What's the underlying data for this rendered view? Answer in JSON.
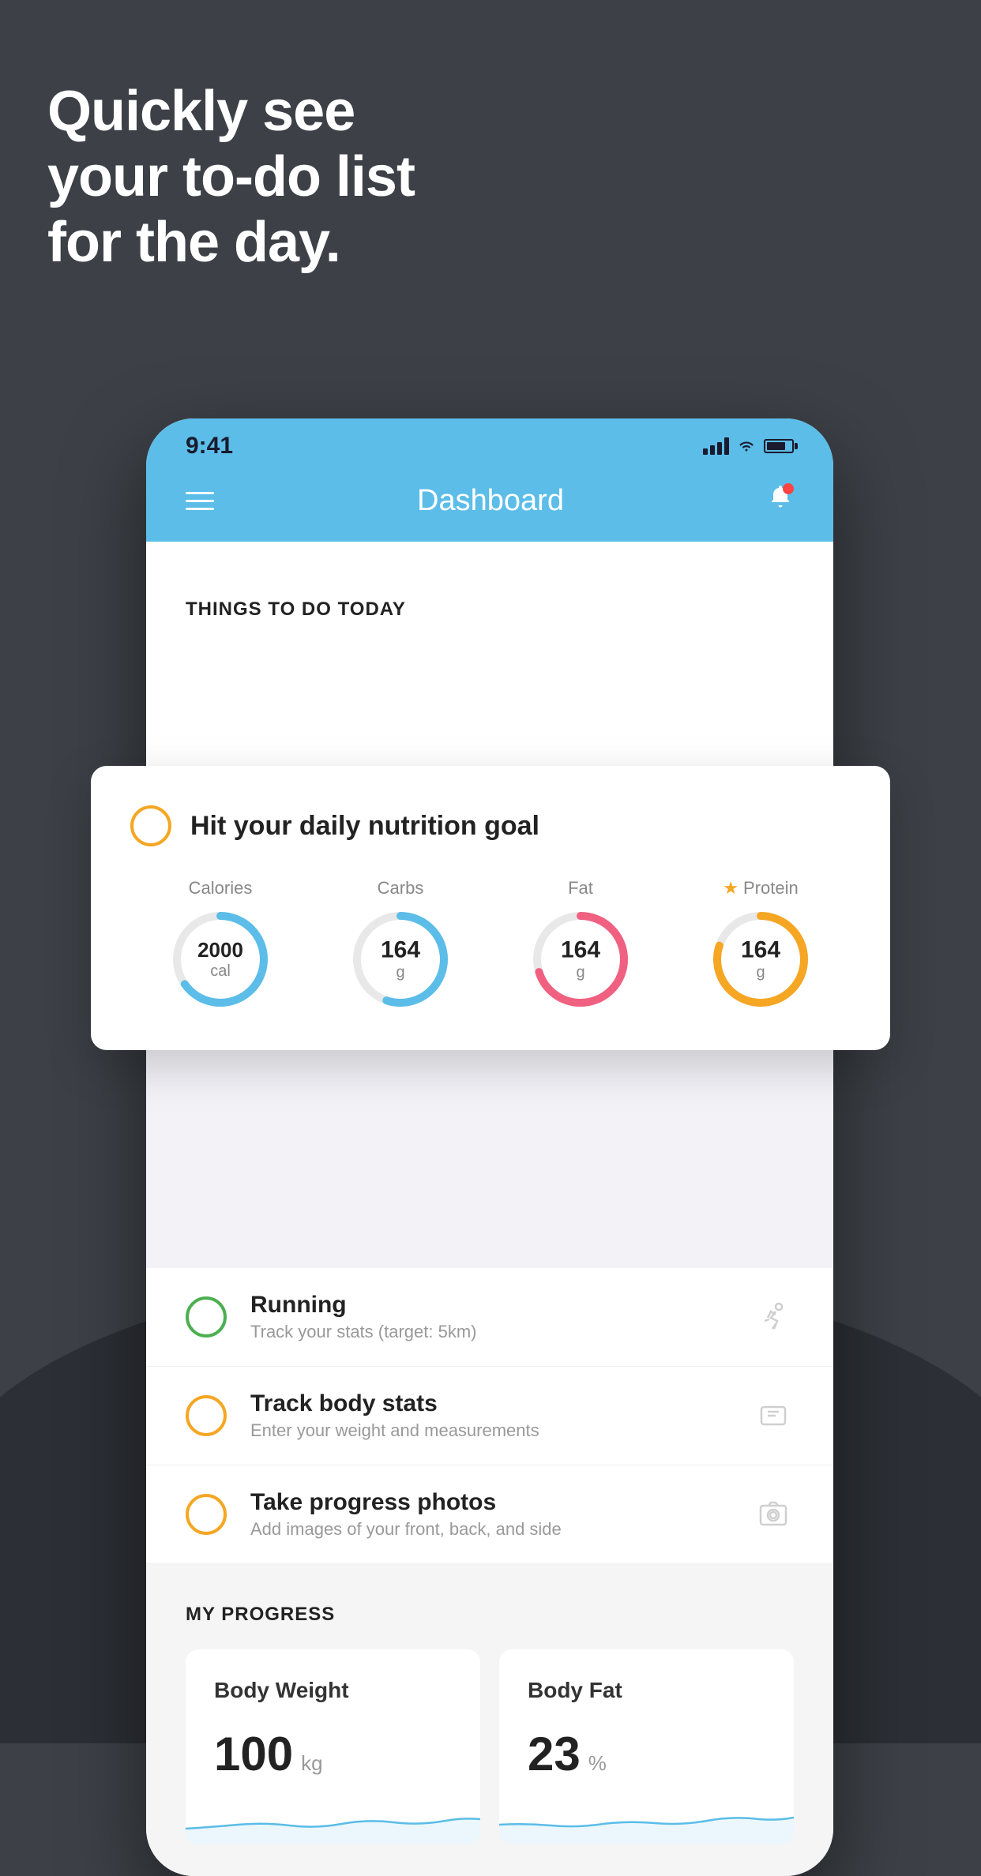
{
  "background": "#3d4147",
  "headline": {
    "line1": "Quickly see",
    "line2": "your to-do list",
    "line3": "for the day."
  },
  "status_bar": {
    "time": "9:41",
    "signal": "signal-icon",
    "wifi": "wifi-icon",
    "battery": "battery-icon"
  },
  "header": {
    "title": "Dashboard",
    "menu_label": "hamburger-menu",
    "bell_label": "notification-bell"
  },
  "things_section": {
    "title": "THINGS TO DO TODAY"
  },
  "nutrition_card": {
    "check_circle_color": "#f5a623",
    "title": "Hit your daily nutrition goal",
    "items": [
      {
        "label": "Calories",
        "value": "2000",
        "unit": "cal",
        "color": "#5bbde8",
        "percent": 65
      },
      {
        "label": "Carbs",
        "value": "164",
        "unit": "g",
        "color": "#5bbde8",
        "percent": 55
      },
      {
        "label": "Fat",
        "value": "164",
        "unit": "g",
        "color": "#f06080",
        "percent": 70
      },
      {
        "label": "Protein",
        "value": "164",
        "unit": "g",
        "color": "#f5a623",
        "percent": 80,
        "starred": true
      }
    ]
  },
  "todo_items": [
    {
      "icon_type": "running",
      "circle_color": "green",
      "name": "Running",
      "desc": "Track your stats (target: 5km)"
    },
    {
      "icon_type": "scale",
      "circle_color": "yellow",
      "name": "Track body stats",
      "desc": "Enter your weight and measurements"
    },
    {
      "icon_type": "photo",
      "circle_color": "yellow",
      "name": "Take progress photos",
      "desc": "Add images of your front, back, and side"
    }
  ],
  "progress_section": {
    "title": "MY PROGRESS",
    "cards": [
      {
        "title": "Body Weight",
        "value": "100",
        "unit": "kg"
      },
      {
        "title": "Body Fat",
        "value": "23",
        "unit": "%"
      }
    ]
  }
}
